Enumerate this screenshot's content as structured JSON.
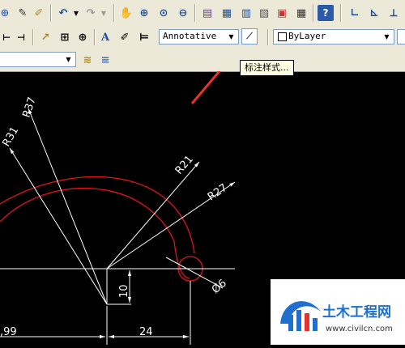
{
  "toolbar": {
    "annotation_scale_value": "Annotative",
    "layer_value": "ByLayer",
    "dimension_style_tooltip": "标注样式..."
  },
  "drawing": {
    "dimensions": {
      "r37": "R37",
      "r31": "R31",
      "r21": "R21",
      "r27": "R27",
      "dia6": "Ø6",
      "len10": "10",
      "len24": "24",
      "len99": ",99"
    }
  },
  "watermark": {
    "title": "土木工程网",
    "url": "www.civilcn.com"
  },
  "colors": {
    "toolbar_bg": "#ece9d8",
    "canvas_bg": "#000000",
    "arc_red": "#e0141e",
    "annotation_arrow": "#e8322b",
    "logo_blue": "#1e6fd0"
  }
}
